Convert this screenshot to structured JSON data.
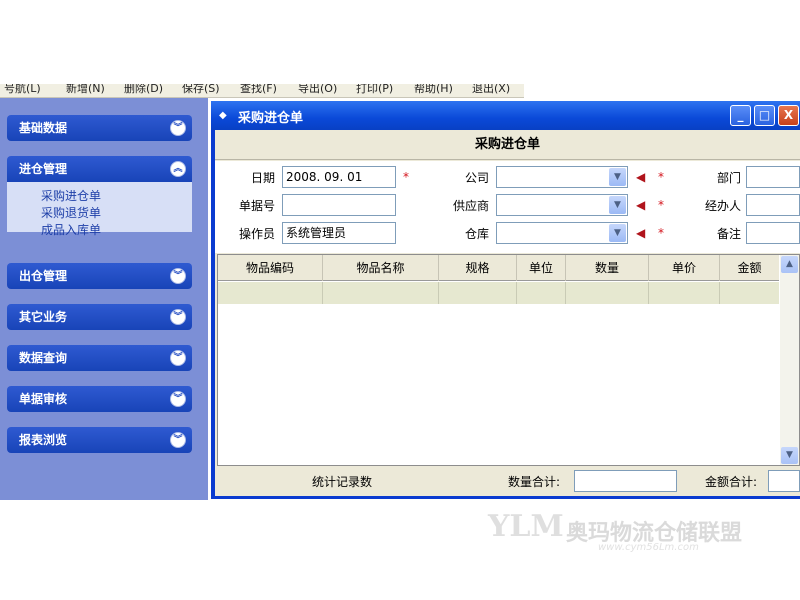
{
  "menubar": {
    "items": [
      "号航(L)",
      "新增(N)",
      "删除(D)",
      "保存(S)",
      "查找(F)",
      "导出(O)",
      "打印(P)",
      "帮助(H)",
      "退出(X)"
    ]
  },
  "sidebar": {
    "groups": [
      {
        "label": "基础数据",
        "expanded": false
      },
      {
        "label": "进仓管理",
        "expanded": true,
        "items": [
          "采购进仓单",
          "采购退货单",
          "成品入库单"
        ]
      },
      {
        "label": "出仓管理",
        "expanded": false
      },
      {
        "label": "其它业务",
        "expanded": false
      },
      {
        "label": "数据查询",
        "expanded": false
      },
      {
        "label": "单据审核",
        "expanded": false
      },
      {
        "label": "报表浏览",
        "expanded": false
      }
    ]
  },
  "window": {
    "title": "采购进仓单",
    "buttons": {
      "minimize": "_",
      "maximize": "□",
      "close": "X"
    }
  },
  "form": {
    "heading": "采购进仓单",
    "date_label": "日期",
    "date_value": "2008. 09. 01",
    "doc_no_label": "单据号",
    "doc_no_value": "",
    "operator_label": "操作员",
    "operator_value": "系统管理员",
    "company_label": "公司",
    "supplier_label": "供应商",
    "warehouse_label": "仓库",
    "dept_label": "部门",
    "handler_label": "经办人",
    "remark_label": "备注",
    "required_mark": "*"
  },
  "grid": {
    "columns": [
      "物品编码",
      "物品名称",
      "规格",
      "单位",
      "数量",
      "单价",
      "金额"
    ]
  },
  "footer": {
    "record_count_label": "统计记录数",
    "qty_total_label": "数量合计:",
    "amount_total_label": "金额合计:"
  },
  "watermark": {
    "logo": "YLM",
    "name": "奥玛物流仓储联盟",
    "url": "www.cym56Lm.com"
  },
  "colors": {
    "sidebar_bg": "#7c8fd6",
    "group_header": "#1844b8",
    "window_frame": "#0a3bd0",
    "form_bg": "#ece9d8",
    "required": "#d4141c"
  }
}
